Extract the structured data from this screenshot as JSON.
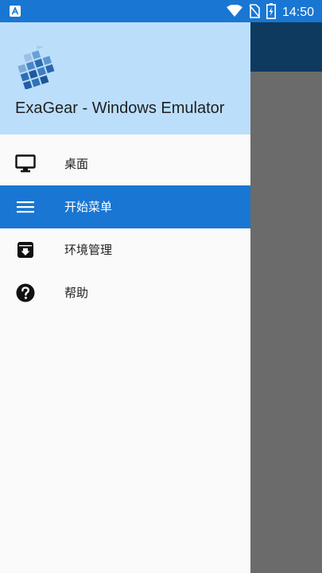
{
  "status_bar": {
    "time": "14:50",
    "left_icon": "a-notification-icon",
    "icons": [
      "wifi-icon",
      "no-sim-icon",
      "battery-charging-icon"
    ]
  },
  "drawer": {
    "header": {
      "title": "ExaGear - Windows Emulator",
      "logo": "exagear-logo"
    },
    "items": [
      {
        "label": "桌面",
        "icon": "monitor-icon",
        "active": false
      },
      {
        "label": "开始菜单",
        "icon": "menu-icon",
        "active": true
      },
      {
        "label": "环境管理",
        "icon": "archive-icon",
        "active": false
      },
      {
        "label": "帮助",
        "icon": "help-icon",
        "active": false
      }
    ]
  },
  "colors": {
    "status_bar": "#1976d2",
    "drawer_header": "#bbdefb",
    "active_item": "#1976d2",
    "background_toolbar": "#0e3a60",
    "scrim": "#6b6b6b"
  }
}
